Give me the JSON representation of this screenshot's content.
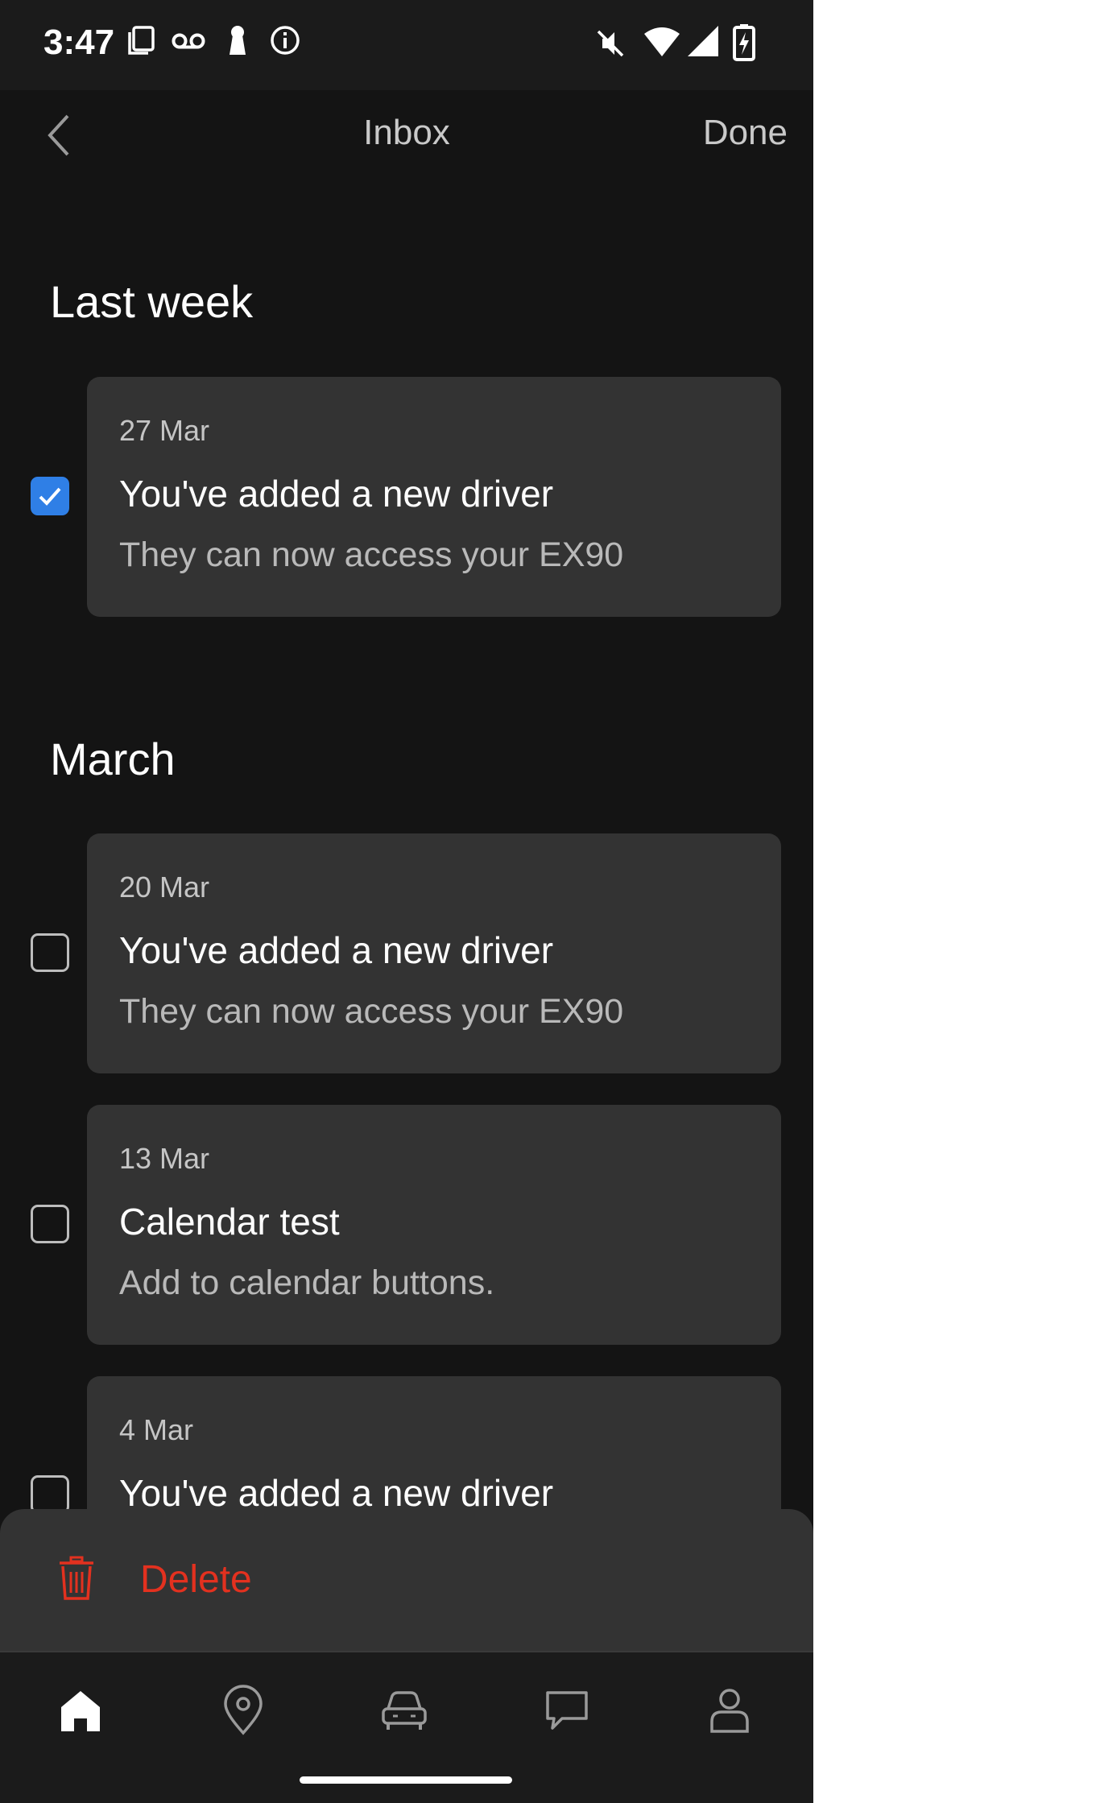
{
  "status_bar": {
    "time": "3:47",
    "left_icons": [
      "screenshot-icon",
      "voicemail-icon",
      "keyhole-icon",
      "info-icon"
    ],
    "right_icons": [
      "mute-icon",
      "wifi-icon",
      "signal-icon",
      "battery-charging-icon"
    ]
  },
  "nav": {
    "title": "Inbox",
    "done_label": "Done",
    "back_icon": "chevron-left-icon"
  },
  "sections": [
    {
      "title": "Last week",
      "items": [
        {
          "date": "27 Mar",
          "title": "You've added a new driver",
          "body": "They can now access your EX90",
          "checked": true
        }
      ]
    },
    {
      "title": "March",
      "items": [
        {
          "date": "20 Mar",
          "title": "You've added a new driver",
          "body": "They can now access your EX90",
          "checked": false
        },
        {
          "date": "13 Mar",
          "title": "Calendar test",
          "body": "Add to calendar buttons.",
          "checked": false
        },
        {
          "date": "4 Mar",
          "title": "You've added a new driver",
          "body": "",
          "checked": false
        }
      ]
    }
  ],
  "action_sheet": {
    "delete_label": "Delete",
    "icon": "trash-icon"
  },
  "tabbar": {
    "icons": [
      "home-icon",
      "location-pin-icon",
      "car-icon",
      "chat-icon",
      "profile-icon"
    ],
    "active": "home-icon"
  },
  "colors": {
    "background": "#141414",
    "card": "#333333",
    "accent_blue": "#2f7fe6",
    "delete_red": "#e3311f"
  }
}
